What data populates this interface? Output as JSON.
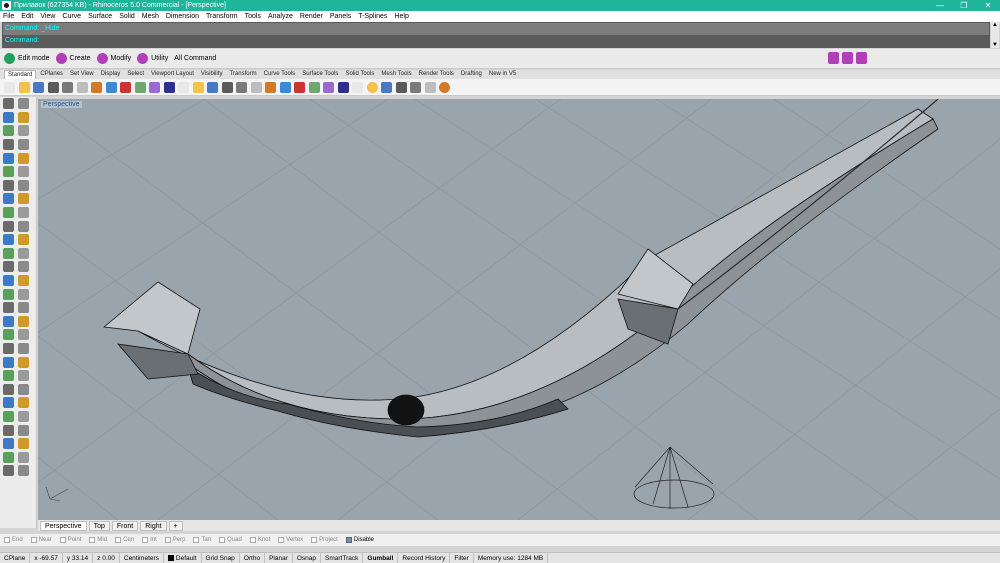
{
  "window": {
    "title": "Прилавок (627354 KB) - Rhinoceros 5.0 Commercial - [Perspective]",
    "controls": [
      "—",
      "❐",
      "✕"
    ]
  },
  "menu": [
    "File",
    "Edit",
    "View",
    "Curve",
    "Surface",
    "Solid",
    "Mesh",
    "Dimension",
    "Transform",
    "Tools",
    "Analyze",
    "Render",
    "Panels",
    "T-Splines",
    "Help"
  ],
  "command": {
    "history": "Command: _Hide",
    "prompt": "Command:"
  },
  "topbar": {
    "buttons": [
      {
        "label": "Edit mode",
        "color": "#23a05a"
      },
      {
        "label": "Create",
        "color": "#b03fb8"
      },
      {
        "label": "Modify",
        "color": "#b03fb8"
      },
      {
        "label": "Utility",
        "color": "#b03fb8"
      }
    ],
    "all_command": "All Command"
  },
  "tabs": [
    "Standard",
    "CPlanes",
    "Set View",
    "Display",
    "Select",
    "Viewport Layout",
    "Visibility",
    "Transform",
    "Curve Tools",
    "Surface Tools",
    "Solid Tools",
    "Mesh Tools",
    "Render Tools",
    "Drafting",
    "New in V5"
  ],
  "toolbar_icons": [
    "new-icon",
    "open-icon",
    "save-icon",
    "print-icon",
    "import-icon",
    "cut-icon",
    "copy-icon",
    "paste-icon",
    "undo-icon",
    "pan-icon",
    "rotate-view-icon",
    "zoom-window-icon",
    "zoom-dynamic-icon",
    "zoom-extents-icon",
    "zoom-selected-icon",
    "undo-view-icon",
    "grid-icon",
    "properties-icon",
    "layer-icon",
    "select-filter-icon",
    "hide-icon",
    "light-icon",
    "lock-icon",
    "named-view-icon",
    "color-wheel-icon",
    "render-icon",
    "material-icon",
    "environment-icon",
    "gear-icon",
    "options-icon",
    "help-icon"
  ],
  "viewport": {
    "label": "Perspective"
  },
  "viewtabs": [
    "Perspective",
    "Top",
    "Front",
    "Right",
    "+"
  ],
  "osnaps": [
    {
      "label": "End",
      "on": false
    },
    {
      "label": "Near",
      "on": false
    },
    {
      "label": "Point",
      "on": false
    },
    {
      "label": "Mid",
      "on": false
    },
    {
      "label": "Cen",
      "on": false
    },
    {
      "label": "Int",
      "on": false
    },
    {
      "label": "Perp",
      "on": false
    },
    {
      "label": "Tan",
      "on": false
    },
    {
      "label": "Quad",
      "on": false
    },
    {
      "label": "Knot",
      "on": false
    },
    {
      "label": "Vertex",
      "on": false
    },
    {
      "label": "Project",
      "on": false
    },
    {
      "label": "Disable",
      "on": true
    }
  ],
  "status": {
    "cplane": "CPlane",
    "x": "x -69.57",
    "y": "y 33.14",
    "z": "z 0.00",
    "units": "Centimeters",
    "layer": "Default",
    "grid_snap": "Grid Snap",
    "ortho": "Ortho",
    "planar": "Planar",
    "osnap": "Osnap",
    "smarttrack": "SmartTrack",
    "gumball": "Gumball",
    "record_history": "Record History",
    "filter": "Filter",
    "memory": "Memory use: 1284 MB"
  },
  "colors": {
    "titlebar": "#1fb59a",
    "viewport_bg": "#9aa4ad",
    "command_text": "#00ffff"
  }
}
